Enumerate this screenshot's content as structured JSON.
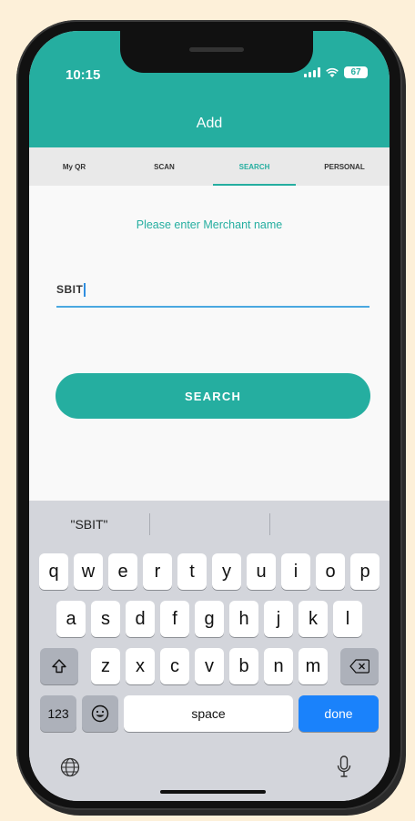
{
  "status": {
    "time": "10:15",
    "battery": "67"
  },
  "header": {
    "title": "Add"
  },
  "tabs": [
    {
      "label": "My QR",
      "active": false
    },
    {
      "label": "SCAN",
      "active": false
    },
    {
      "label": "SEARCH",
      "active": true
    },
    {
      "label": "PERSONAL",
      "active": false
    }
  ],
  "search": {
    "prompt": "Please enter Merchant name",
    "value": "SBIT",
    "button_label": "SEARCH"
  },
  "keyboard": {
    "suggestions": [
      "\"SBIT\"",
      "",
      ""
    ],
    "row1": [
      "q",
      "w",
      "e",
      "r",
      "t",
      "y",
      "u",
      "i",
      "o",
      "p"
    ],
    "row2": [
      "a",
      "s",
      "d",
      "f",
      "g",
      "h",
      "j",
      "k",
      "l"
    ],
    "row3": [
      "z",
      "x",
      "c",
      "v",
      "b",
      "n",
      "m"
    ],
    "numbers_label": "123",
    "space_label": "space",
    "done_label": "done"
  },
  "colors": {
    "accent": "#25aea0",
    "done": "#1a82fb",
    "background": "#fdf0d9"
  }
}
